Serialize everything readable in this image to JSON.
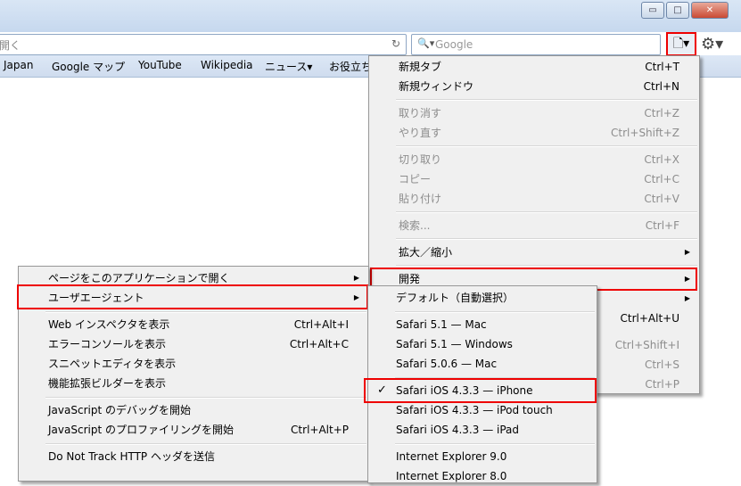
{
  "window": {
    "minimize_glyph": "▭",
    "maximize_glyph": "□",
    "close_glyph": "✕"
  },
  "urlbar": {
    "text": "開く",
    "reload_glyph": "↻"
  },
  "search": {
    "placeholder": "Google",
    "icon_glyph": "🔍▾"
  },
  "toolbar": {
    "page_glyph": "🗋▾",
    "gear_glyph": "⚙▾"
  },
  "bookmarks": [
    "Japan",
    "Google マップ",
    "YouTube",
    "Wikipedia",
    "ニュース▾",
    "お役立ち"
  ],
  "page_menu": {
    "items": [
      {
        "label": "新規タブ",
        "shortcut": "Ctrl+T",
        "disabled": false
      },
      {
        "label": "新規ウィンドウ",
        "shortcut": "Ctrl+N",
        "disabled": false
      },
      {
        "label": "取り消す",
        "shortcut": "Ctrl+Z",
        "disabled": true
      },
      {
        "label": "やり直す",
        "shortcut": "Ctrl+Shift+Z",
        "disabled": true
      },
      {
        "label": "切り取り",
        "shortcut": "Ctrl+X",
        "disabled": true
      },
      {
        "label": "コピー",
        "shortcut": "Ctrl+C",
        "disabled": true
      },
      {
        "label": "貼り付け",
        "shortcut": "Ctrl+V",
        "disabled": true
      },
      {
        "label": "検索...",
        "shortcut": "Ctrl+F",
        "disabled": true
      },
      {
        "label": "拡大／縮小",
        "shortcut": "",
        "disabled": false
      },
      {
        "label": "開発",
        "shortcut": "",
        "disabled": false
      }
    ],
    "partial_shortcuts": [
      "Ctrl+Alt+U",
      "Ctrl+Shift+I",
      "Ctrl+S",
      "Ctrl+P"
    ]
  },
  "develop_menu": {
    "items": [
      {
        "label": "ページをこのアプリケーションで開く",
        "shortcut": ""
      },
      {
        "label": "ユーザエージェント",
        "shortcut": ""
      },
      {
        "label": "Web インスペクタを表示",
        "shortcut": "Ctrl+Alt+I"
      },
      {
        "label": "エラーコンソールを表示",
        "shortcut": "Ctrl+Alt+C"
      },
      {
        "label": "スニペットエディタを表示",
        "shortcut": ""
      },
      {
        "label": "機能拡張ビルダーを表示",
        "shortcut": ""
      },
      {
        "label": "JavaScript のデバッグを開始",
        "shortcut": ""
      },
      {
        "label": "JavaScript のプロファイリングを開始",
        "shortcut": "Ctrl+Alt+P"
      },
      {
        "label": "Do Not Track HTTP ヘッダを送信",
        "shortcut": ""
      }
    ]
  },
  "ua_menu": {
    "items": [
      {
        "label": "デフォルト（自動選択）"
      },
      {
        "label": "Safari 5.1 — Mac"
      },
      {
        "label": "Safari 5.1 — Windows"
      },
      {
        "label": "Safari 5.0.6 — Mac"
      },
      {
        "label": "Safari iOS 4.3.3 — iPhone"
      },
      {
        "label": "Safari iOS 4.3.3 — iPod touch"
      },
      {
        "label": "Safari iOS 4.3.3 — iPad"
      },
      {
        "label": "Internet Explorer 9.0"
      },
      {
        "label": "Internet Explorer 8.0"
      }
    ],
    "selected_index": 4,
    "check_glyph": "✓"
  },
  "arrow_glyph": "▶",
  "colors": {
    "highlight_border": "#e00000"
  }
}
